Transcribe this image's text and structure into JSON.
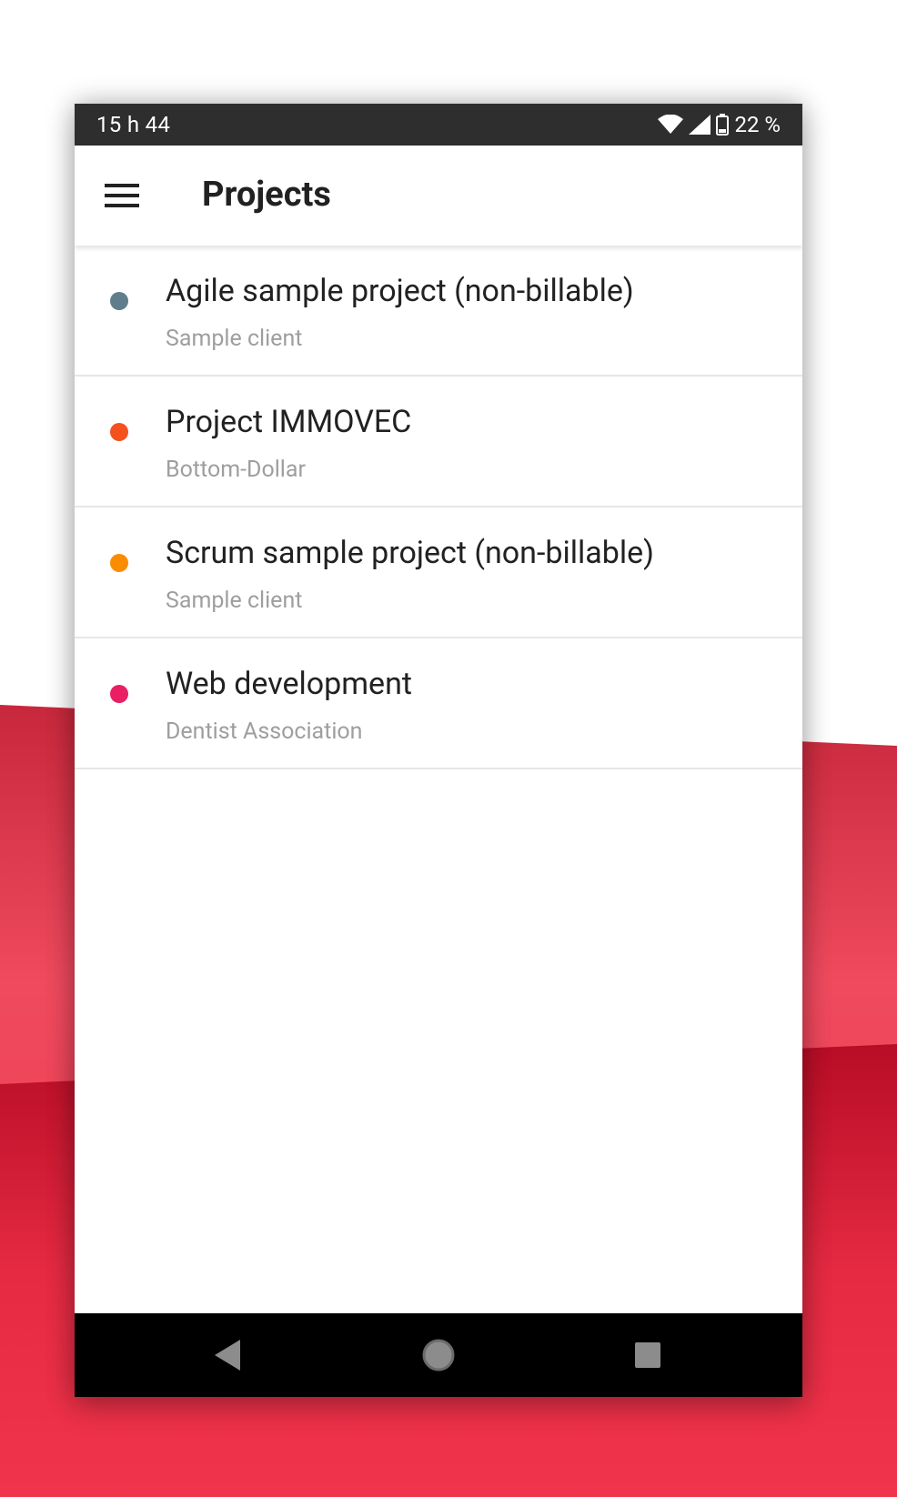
{
  "status_bar": {
    "time": "15 h 44",
    "battery": "22 %",
    "icons": [
      "wifi-icon",
      "signal-icon",
      "battery-icon"
    ]
  },
  "app_bar": {
    "menu_icon": "hamburger-menu-icon",
    "title": "Projects"
  },
  "projects": [
    {
      "name": "Agile sample project (non-billable)",
      "client": "Sample client",
      "color": "#607d8b"
    },
    {
      "name": "Project IMMOVEC",
      "client": "Bottom-Dollar",
      "color": "#f4511e"
    },
    {
      "name": "Scrum sample project (non-billable)",
      "client": "Sample client",
      "color": "#fb8c00"
    },
    {
      "name": "Web development",
      "client": "Dentist Association",
      "color": "#e91e63"
    }
  ],
  "nav_bar": {
    "icons": [
      "back-icon",
      "home-icon",
      "recents-icon"
    ]
  },
  "colors": {
    "status_bar_bg": "#2e2e2e",
    "background_accent": "#f0344b",
    "text_primary": "#212121",
    "text_secondary": "#9e9e9e"
  }
}
